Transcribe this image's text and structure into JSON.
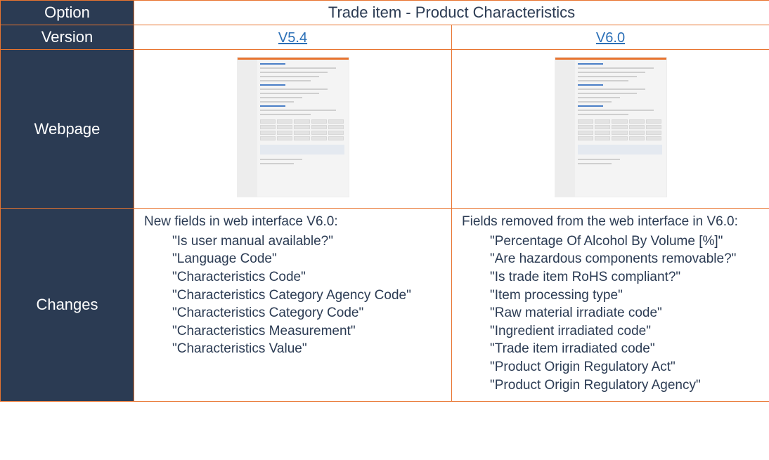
{
  "labels": {
    "option": "Option",
    "version": "Version",
    "webpage": "Webpage",
    "changes": "Changes"
  },
  "title": "Trade item - Product Characteristics",
  "versions": {
    "left": "V5.4",
    "right": "V6.0"
  },
  "changes": {
    "left": {
      "intro": "New fields in web interface V6.0:",
      "items": [
        "Is user manual available?",
        "Language Code",
        "Characteristics Code",
        "Characteristics Category Agency Code",
        "Characteristics Category Code",
        "Characteristics Measurement",
        "Characteristics Value"
      ]
    },
    "right": {
      "intro": "Fields removed from the web interface in V6.0:",
      "items": [
        "Percentage Of Alcohol By Volume [%]",
        "Are hazardous components removable?",
        "Is trade item RoHS compliant?",
        "Item processing type",
        "Raw material irradiate code",
        "Ingredient irradiated code",
        "Trade item irradiated code",
        "Product Origin Regulatory Act",
        "Product Origin Regulatory Agency"
      ]
    }
  }
}
